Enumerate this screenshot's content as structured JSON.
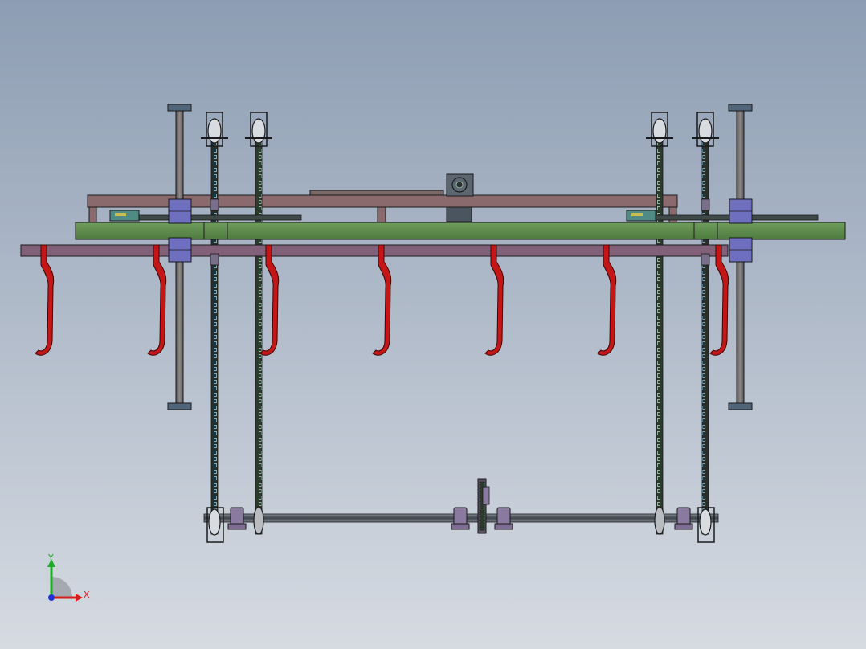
{
  "viewport": {
    "background_top": "#8d9db3",
    "background_bottom": "#d6dbe2"
  },
  "triad": {
    "x_label": "X",
    "y_label": "Y",
    "x_color": "#d42020",
    "y_color": "#1faa2a",
    "z_color": "#2430d8"
  },
  "colors": {
    "frame_beam": "#8b6a6e",
    "guide_rail": "#5a8a4a",
    "hook_bar": "#83607a",
    "hook": "#c41616",
    "column": "#6e6a6a",
    "bearing_block": "#6e6fbe",
    "chain": "#3a4a3a",
    "chain_highlight": "#6fb0c8",
    "shaft": "#4a5058",
    "pillow_block": "#8a7aa0",
    "motor": "#4a5560",
    "outline": "#1a1a1a"
  },
  "components": {
    "hooks": [
      {
        "name": "hook-1"
      },
      {
        "name": "hook-2"
      },
      {
        "name": "hook-3"
      },
      {
        "name": "hook-4"
      },
      {
        "name": "hook-5"
      },
      {
        "name": "hook-6"
      },
      {
        "name": "hook-7"
      }
    ],
    "chains": [
      {
        "name": "chain-left-outer"
      },
      {
        "name": "chain-left-inner"
      },
      {
        "name": "chain-right-inner"
      },
      {
        "name": "chain-right-outer"
      }
    ],
    "columns": [
      {
        "name": "guide-column-left"
      },
      {
        "name": "guide-column-right"
      }
    ]
  }
}
